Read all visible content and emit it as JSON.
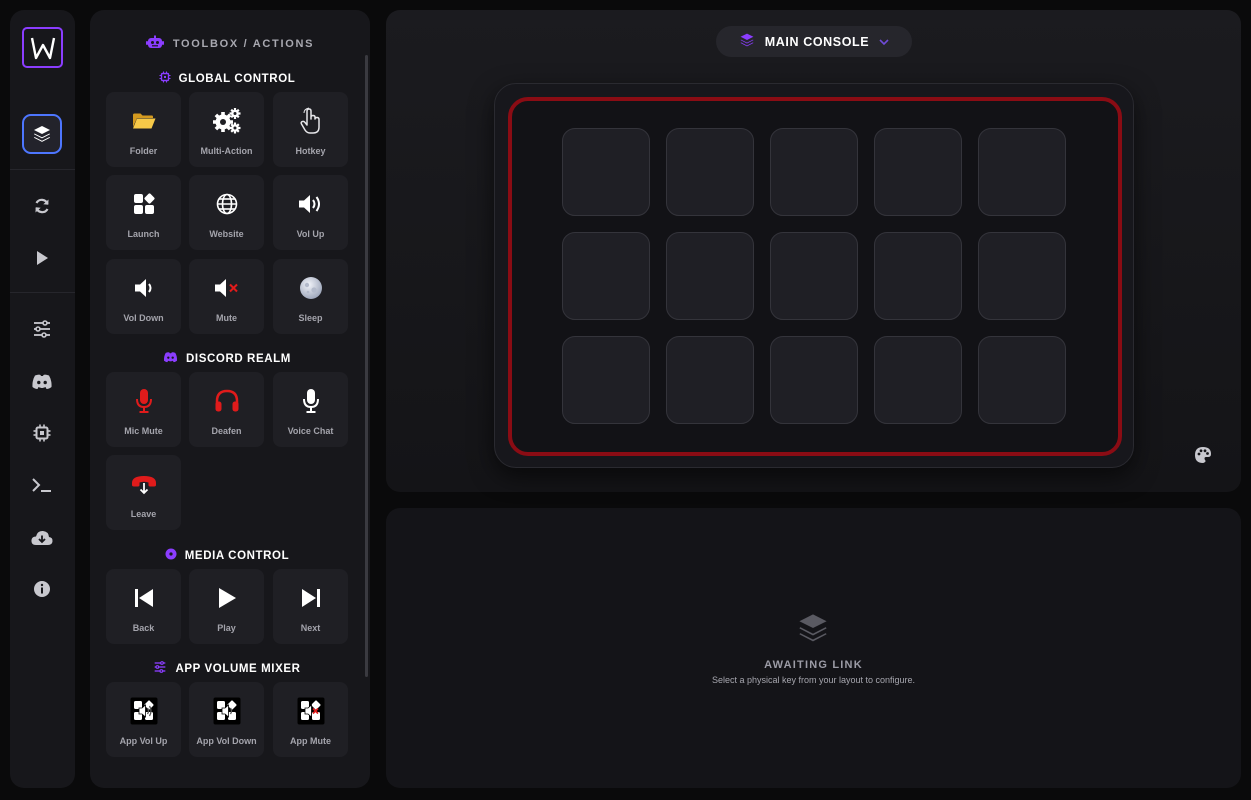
{
  "toolbox": {
    "header": "TOOLBOX / ACTIONS",
    "sections": [
      {
        "title": "GLOBAL CONTROL",
        "items": [
          "Folder",
          "Multi-Action",
          "Hotkey",
          "Launch",
          "Website",
          "Vol Up",
          "Vol Down",
          "Mute",
          "Sleep"
        ]
      },
      {
        "title": "DISCORD REALM",
        "items": [
          "Mic Mute",
          "Deafen",
          "Voice Chat",
          "Leave"
        ]
      },
      {
        "title": "MEDIA CONTROL",
        "items": [
          "Back",
          "Play",
          "Next"
        ]
      },
      {
        "title": "APP VOLUME MIXER",
        "items": [
          "App Vol Up",
          "App Vol Down",
          "App Mute"
        ]
      }
    ]
  },
  "rail": {
    "items": [
      "logo-icon",
      "layers-icon",
      "sync-icon",
      "play-icon",
      "sliders-icon",
      "discord-icon",
      "chip-icon",
      "terminal-icon",
      "cloud-download-icon",
      "info-icon"
    ]
  },
  "console": {
    "profile": "MAIN CONSOLE",
    "key_count": 15
  },
  "config": {
    "title": "AWAITING LINK",
    "subtitle": "Select a physical key from your layout to configure."
  },
  "colors": {
    "accent": "#8b3dff",
    "active_border": "#4d76ff",
    "deck_frame": "#8a0c14",
    "discord_red": "#e01b1b"
  }
}
